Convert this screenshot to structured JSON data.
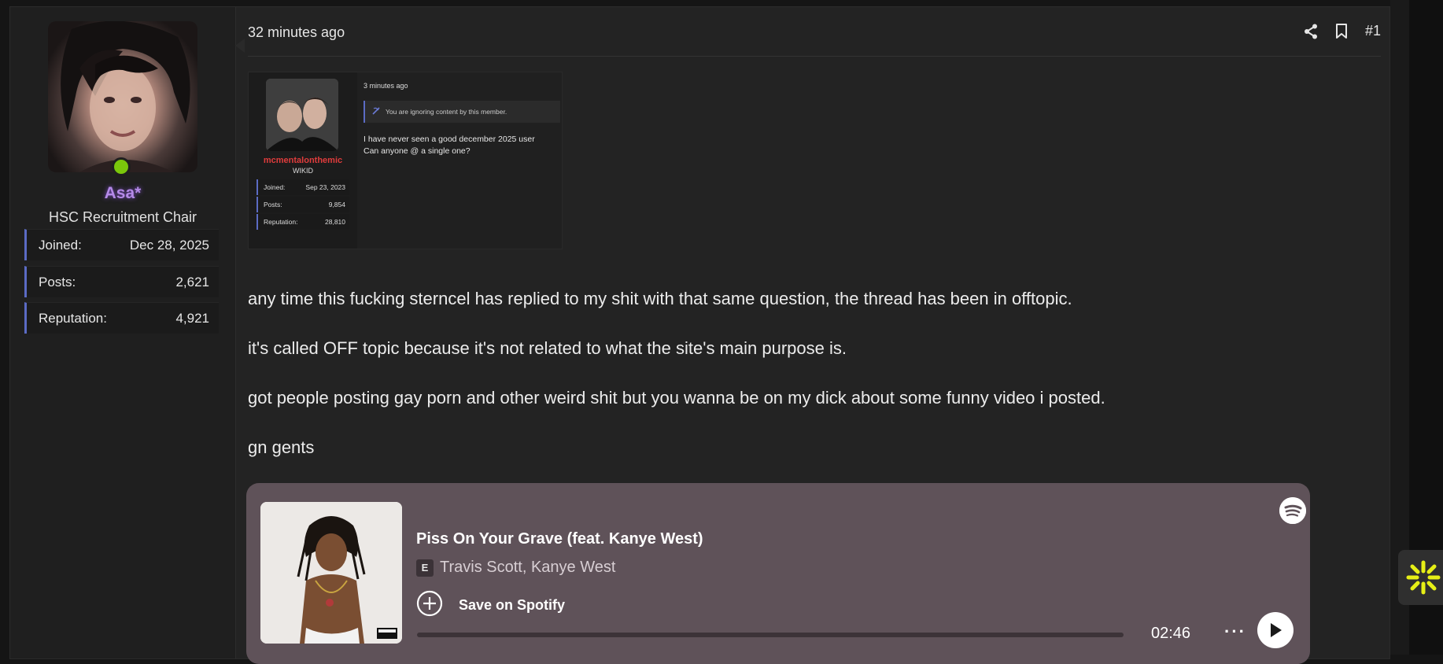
{
  "user": {
    "username": "Asa*",
    "user_title": "HSC Recruitment Chair",
    "stats": [
      {
        "label": "Joined:",
        "value": "Dec 28, 2025"
      },
      {
        "label": "Posts:",
        "value": "2,621"
      },
      {
        "label": "Reputation:",
        "value": "4,921"
      }
    ],
    "online_color": "#7ac70b",
    "name_color": "#b58ae8"
  },
  "post": {
    "time": "32 minutes ago",
    "post_number": "#1",
    "actions": [
      "share-icon",
      "bookmark-icon"
    ]
  },
  "embedded_screenshot": {
    "username": "mcmentalonthemic",
    "user_title": "WIKID",
    "stats": [
      {
        "label": "Joined:",
        "value": "Sep 23, 2023"
      },
      {
        "label": "Posts:",
        "value": "9,854"
      },
      {
        "label": "Reputation:",
        "value": "28,810"
      }
    ],
    "time": "3 minutes ago",
    "ignore_notice": "You are ignoring content by this member.",
    "message_lines": [
      "I have never seen a good december 2025 user",
      "Can anyone @ a single one?"
    ]
  },
  "paragraphs": [
    "any time this fucking sterncel has replied to my shit with that same question, the thread has been in offtopic.",
    "it's called OFF topic because it's not related to what the site's main purpose is.",
    "got people posting gay porn and other weird shit but you wanna be on my dick about some funny video i posted.",
    "gn gents"
  ],
  "spotify": {
    "track_title": "Piss On Your Grave (feat. Kanye West)",
    "explicit_label": "E",
    "artists": "Travis Scott, Kanye West",
    "save_label": "Save on Spotify",
    "duration": "02:46",
    "progress": 0,
    "bg_color": "#5f5259"
  }
}
